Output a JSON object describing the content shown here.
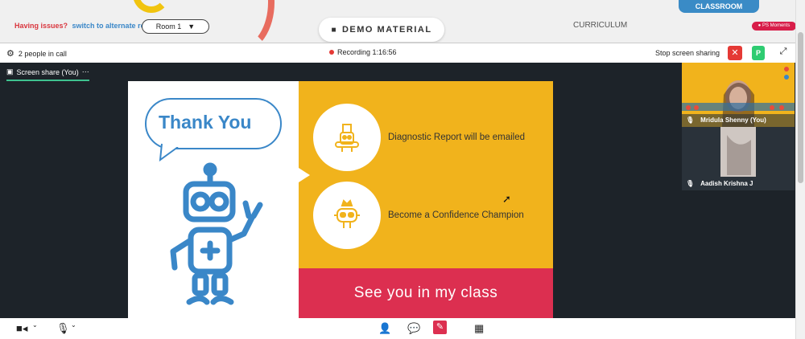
{
  "header": {
    "issues_text": "Having issues?",
    "switch_link": "switch to alternate room",
    "room_select": "Room 1",
    "demo_button": "DEMO MATERIAL",
    "curriculum_tab": "CURRICULUM",
    "classroom_tab": "CLASSROOM",
    "ps_moments_badge": "PS Moments"
  },
  "call_bar": {
    "people_count": "2 people in call",
    "recording_label": "Recording 1:16:56",
    "stop_sharing": "Stop screen sharing",
    "participant_badge": "P"
  },
  "stage": {
    "screen_share_tab": "Screen share (You)",
    "more_glyph": "⋯"
  },
  "slide": {
    "bubble_text": "Thank You",
    "items": [
      {
        "text": "Diagnostic Report will be emailed",
        "icon": "report-robot-icon"
      },
      {
        "text": "Become a Confidence Champion",
        "icon": "crown-robot-icon"
      }
    ],
    "footer": "See you in my class",
    "colors": {
      "yellow": "#f1b31c",
      "red": "#dc2f50",
      "blue": "#3a87c8"
    }
  },
  "participants": [
    {
      "name": "Mridula Shenny (You)"
    },
    {
      "name": "Aadish Krishna J"
    }
  ],
  "toolbar": {
    "icons": [
      "camera-icon",
      "microphone-icon",
      "person-icon",
      "chat-icon",
      "whiteboard-icon",
      "grid-icon"
    ]
  }
}
